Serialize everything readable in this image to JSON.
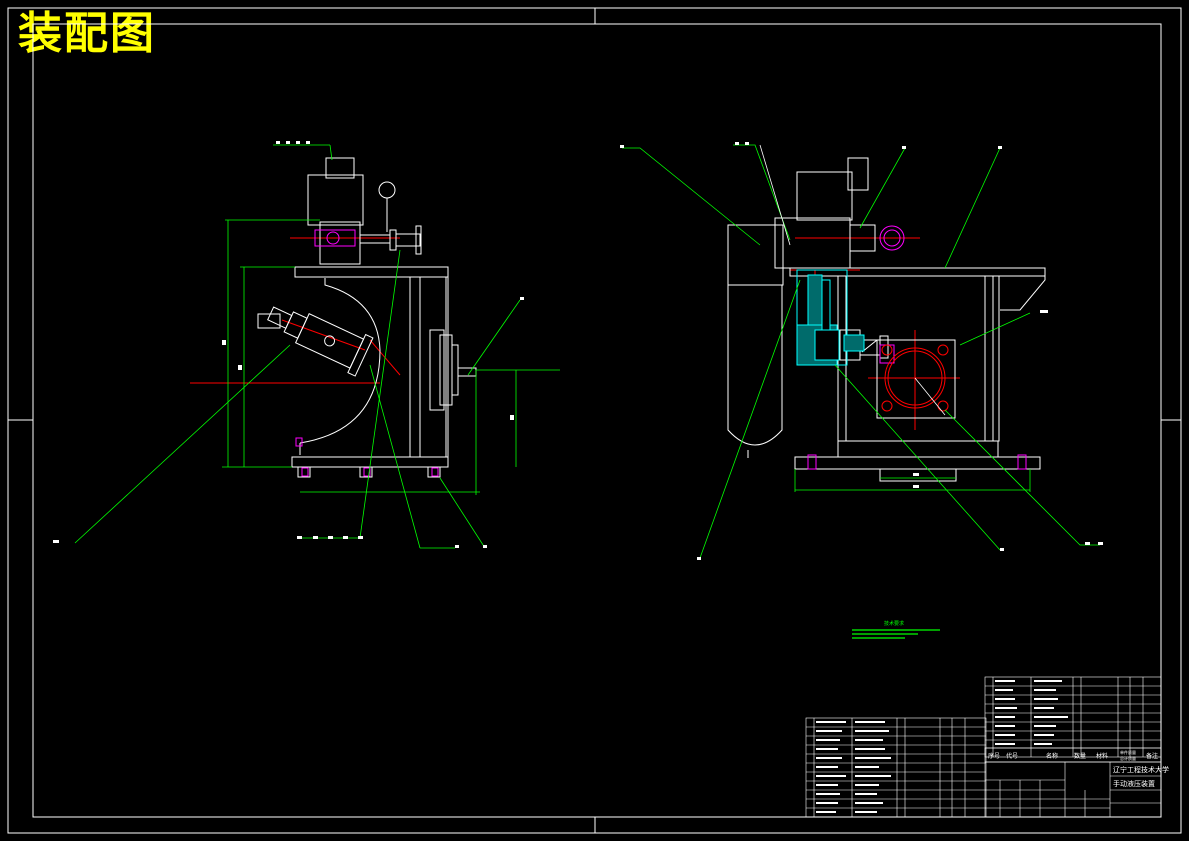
{
  "title": "装配图",
  "colors": {
    "background": "#000000",
    "frame": "#ffffff",
    "outline": "#ffffff",
    "leader": "#00ff00",
    "centerline": "#ff0000",
    "hatch": "#00ffff",
    "detail": "#ff00ff",
    "title": "#ffff00"
  },
  "tech_notes": {
    "heading": "技术要求"
  },
  "title_block": {
    "school": "辽宁工程技术大学",
    "drawing_name": "手动液压装置",
    "header_row": [
      "序号",
      "代号",
      "名称",
      "数量",
      "材料",
      "单件质量",
      "总计质量",
      "备注"
    ]
  }
}
